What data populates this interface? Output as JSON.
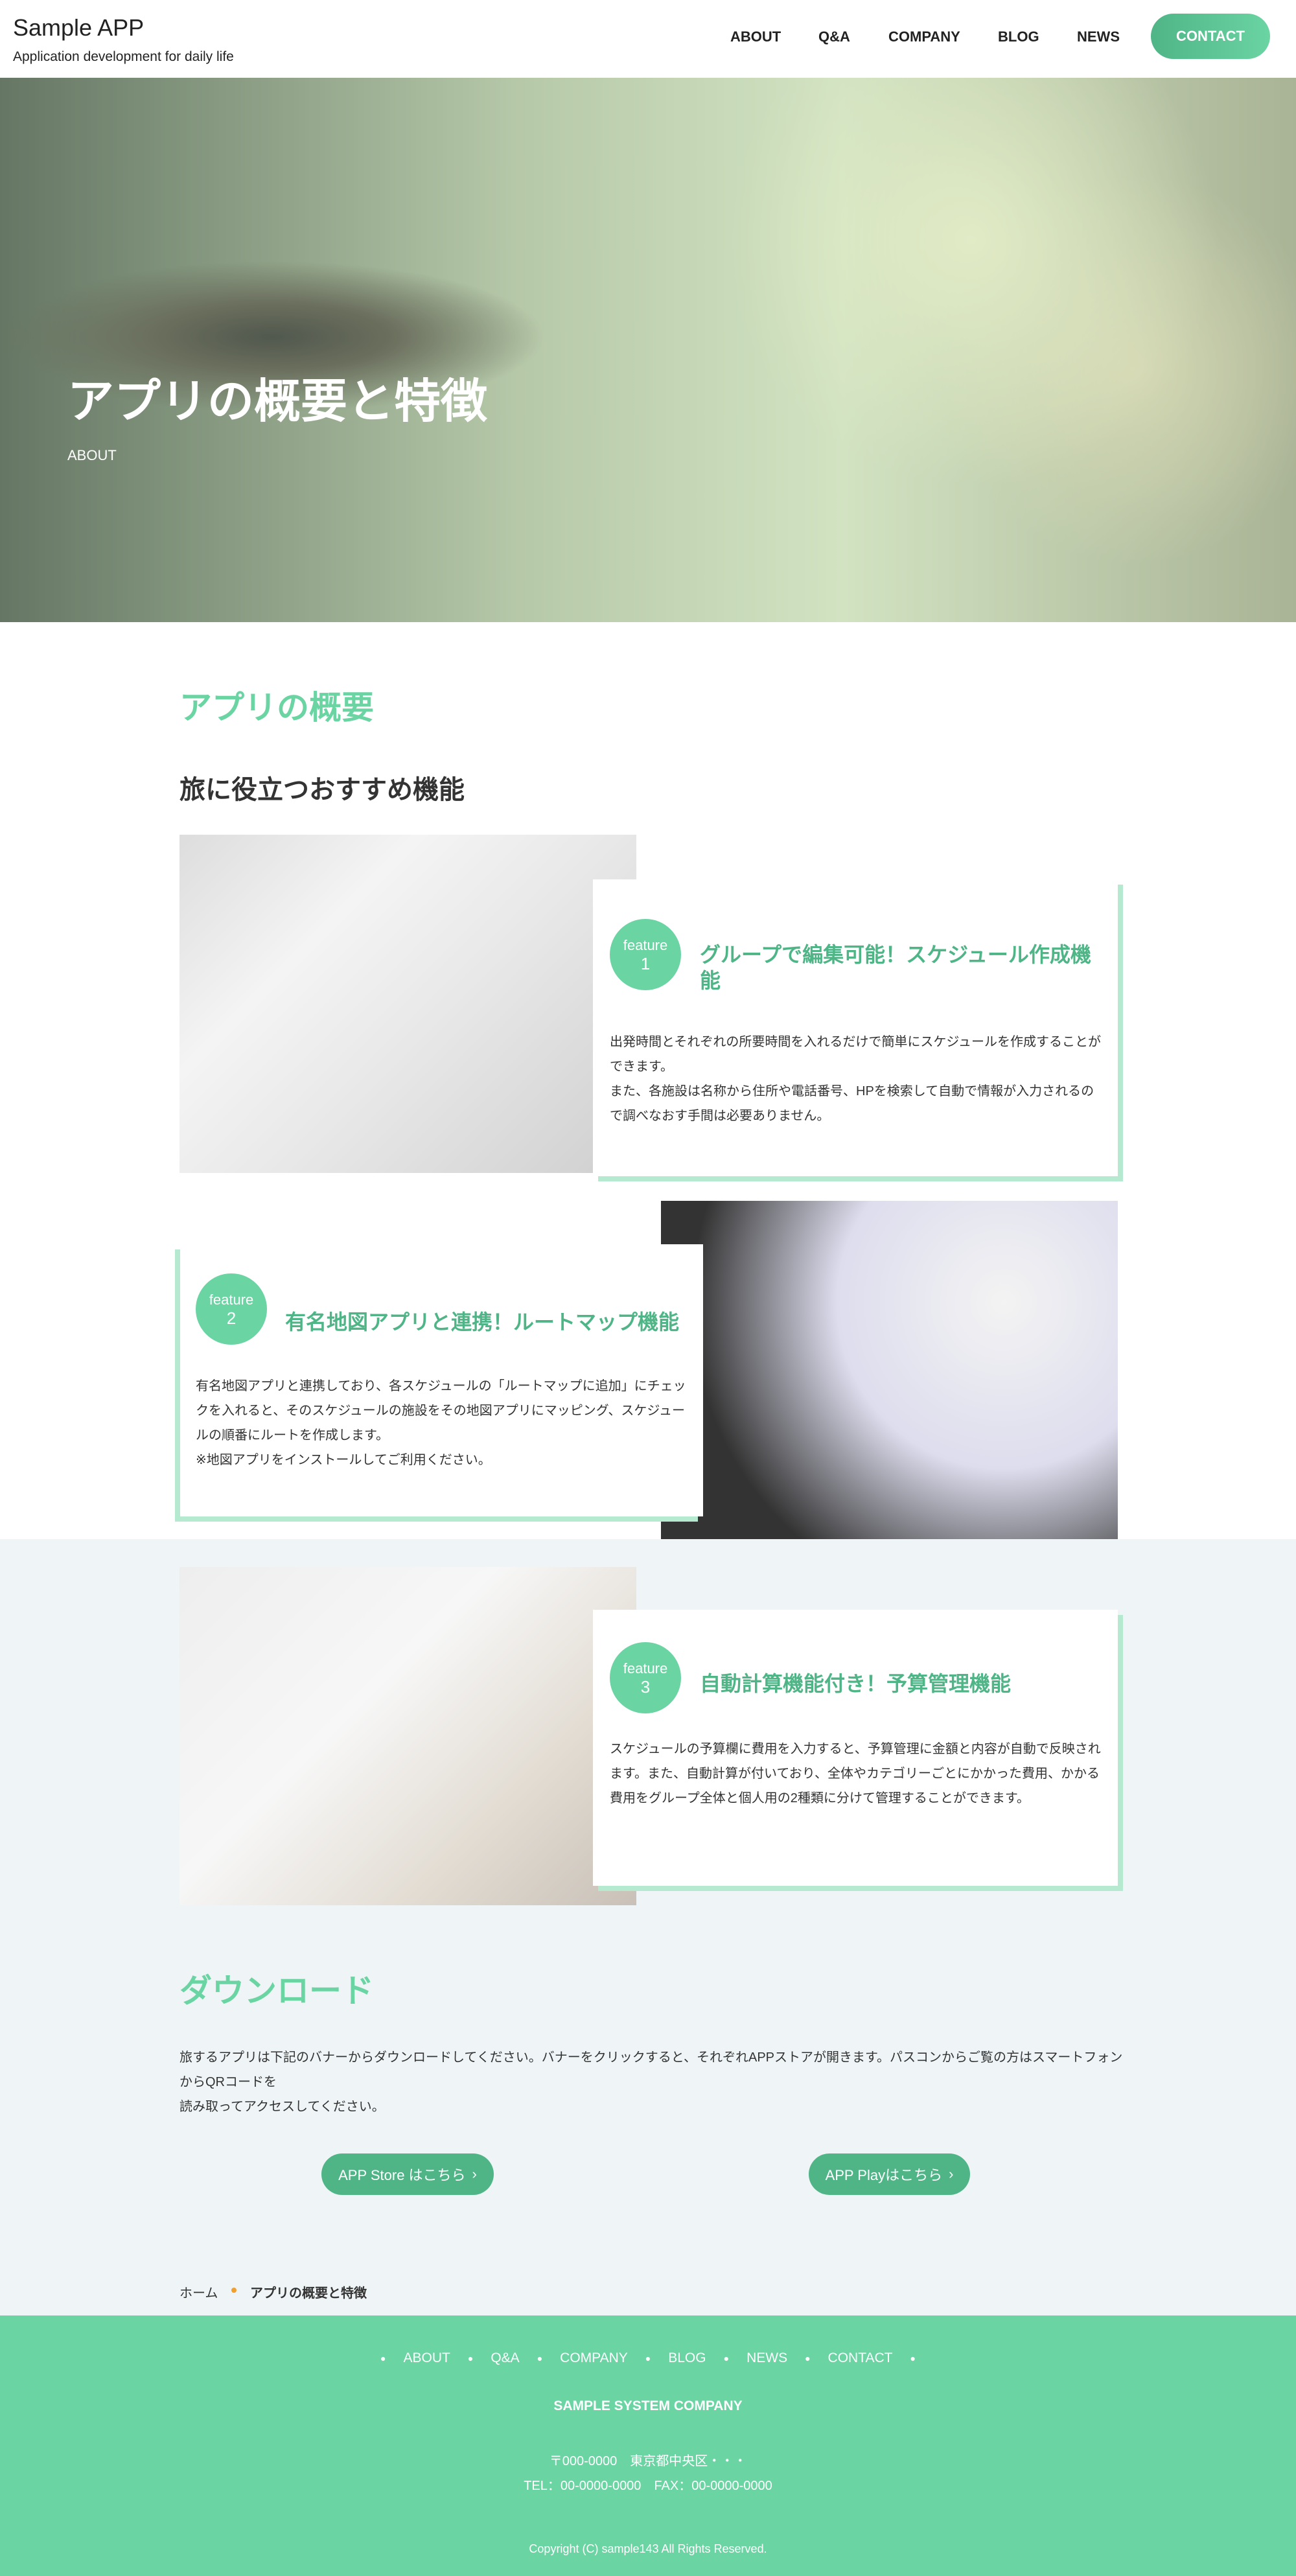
{
  "header": {
    "title": "Sample APP",
    "tagline": "Application development for daily life",
    "nav": [
      "ABOUT",
      "Q&A",
      "COMPANY",
      "BLOG",
      "NEWS"
    ],
    "contact": "CONTACT"
  },
  "hero": {
    "title": "アプリの概要と特徴",
    "subtitle": "ABOUT"
  },
  "overview": {
    "heading": "アプリの概要",
    "subheading": "旅に役立つおすすめ機能"
  },
  "features": [
    {
      "label": "feature",
      "num": "1",
      "title": "グループで編集可能！スケジュール作成機能",
      "body": "出発時間とそれぞれの所要時間を入れるだけで簡単にスケジュールを作成することができます。\nまた、各施設は名称から住所や電話番号、HPを検索して自動で情報が入力されるので調べなおす手間は必要ありません。"
    },
    {
      "label": "feature",
      "num": "2",
      "title": "有名地図アプリと連携！ルートマップ機能",
      "body": "有名地図アプリと連携しており、各スケジュールの「ルートマップに追加」にチェックを入れると、そのスケジュールの施設をその地図アプリにマッピング、スケジュールの順番にルートを作成します。\n※地図アプリをインストールしてご利用ください。"
    },
    {
      "label": "feature",
      "num": "3",
      "title": "自動計算機能付き！予算管理機能",
      "body": "スケジュールの予算欄に費用を入力すると、予算管理に金額と内容が自動で反映されます。また、自動計算が付いており、全体やカテゴリーごとにかかった費用、かかる費用をグループ全体と個人用の2種類に分けて管理することができます。"
    }
  ],
  "download": {
    "heading": "ダウンロード",
    "text": "旅するアプリは下記のバナーからダウンロードしてください。バナーをクリックすると、それぞれAPPストアが開きます。パスコンからご覧の方はスマートフォンからQRコードを\n読み取ってアクセスしてください。",
    "store": "APP Store はこちら",
    "play": "APP Playはこちら"
  },
  "breadcrumb": {
    "home": "ホーム",
    "current": "アプリの概要と特徴"
  },
  "footer": {
    "nav": [
      "ABOUT",
      "Q&A",
      "COMPANY",
      "BLOG",
      "NEWS",
      "CONTACT"
    ],
    "company": "SAMPLE SYSTEM COMPANY",
    "address": "〒000-0000　東京都中央区・・・",
    "tel": "TEL：00-0000-0000　FAX：00-0000-0000",
    "copyright": "Copyright (C) sample143 All Rights Reserved."
  },
  "colors": {
    "accent": "#6bd4a3",
    "accent_dark": "#4fb587",
    "shadow": "#b5ead0",
    "light_bg": "#eff5f7",
    "breadcrumb_dot": "#f0a030"
  }
}
